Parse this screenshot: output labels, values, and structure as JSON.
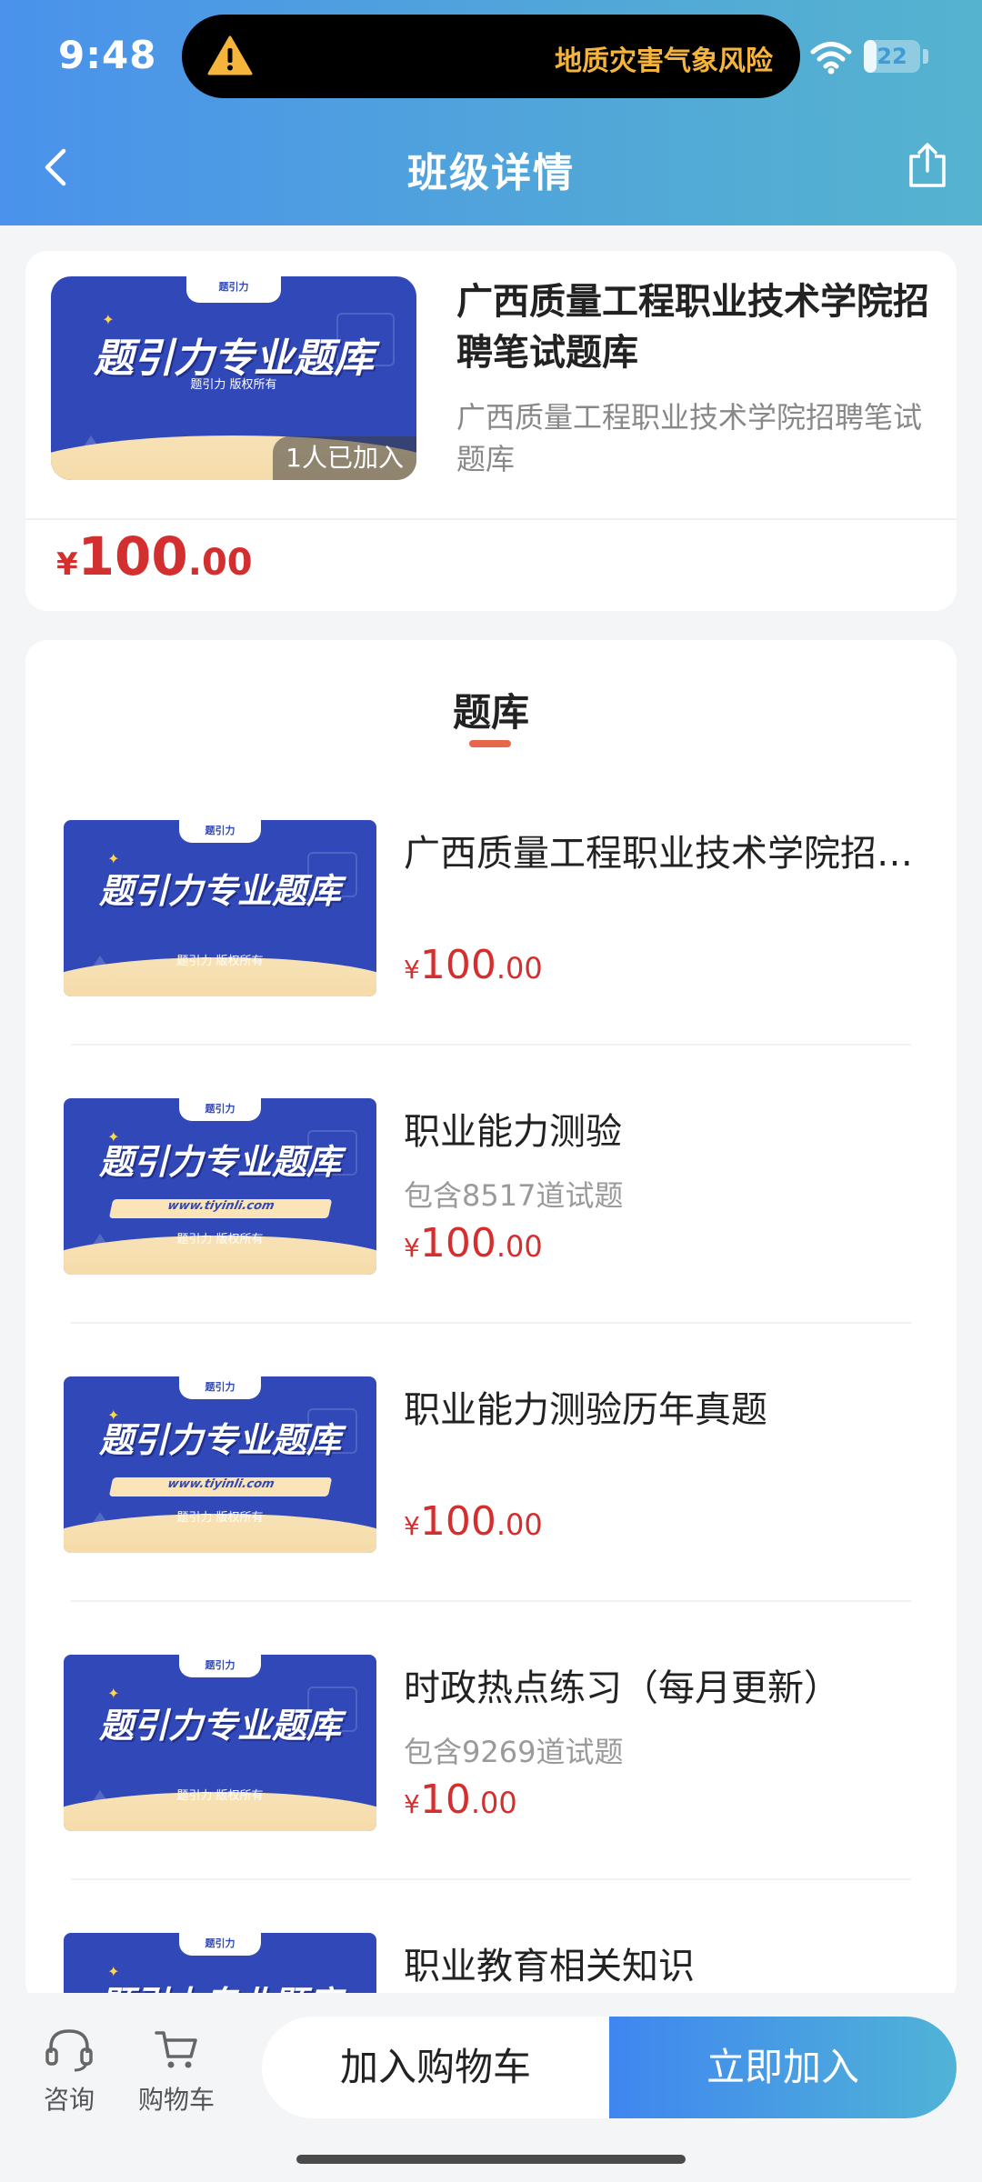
{
  "status_bar": {
    "time": "9:48",
    "alert_text": "地质灾害气象风险",
    "battery": "22",
    "battery_level": 0.22
  },
  "nav": {
    "title": "班级详情",
    "back_icon": "chevron-left-icon",
    "share_icon": "share-icon"
  },
  "summary": {
    "title": "广西质量工程职业技术学院招聘笔试题库",
    "subtitle": "广西质量工程职业技术学院招聘笔试题库",
    "joined": "1人已加入",
    "price": {
      "yen": "¥",
      "integer": "100",
      "decimal": ".00"
    }
  },
  "thumbnail": {
    "brand": "题引力",
    "title": "题引力专业题库",
    "copyright": "题引力 版权所有",
    "url": "www.tiyinli.com"
  },
  "section": {
    "title": "题库"
  },
  "banks": [
    {
      "title": "广西质量工程职业技术学院招聘笔试题库",
      "count": "",
      "price": {
        "yen": "¥",
        "integer": "100",
        "decimal": ".00"
      }
    },
    {
      "title": "职业能力测验",
      "count": "包含8517道试题",
      "price": {
        "yen": "¥",
        "integer": "100",
        "decimal": ".00"
      }
    },
    {
      "title": "职业能力测验历年真题",
      "count": "",
      "price": {
        "yen": "¥",
        "integer": "100",
        "decimal": ".00"
      }
    },
    {
      "title": "时政热点练习（每月更新）",
      "count": "包含9269道试题",
      "price": {
        "yen": "¥",
        "integer": "10",
        "decimal": ".00"
      }
    },
    {
      "title": "职业教育相关知识",
      "count": "",
      "price": {
        "yen": "",
        "integer": "",
        "decimal": ""
      }
    }
  ],
  "bottom_bar": {
    "consult_label": "咨询",
    "cart_label": "购物车",
    "add_to_cart": "加入购物车",
    "join_now": "立即加入"
  },
  "colors": {
    "header_start": "#4a92ec",
    "header_end": "#55b3cf",
    "price_red": "#d32f2f",
    "accent_underline": "#e8664a",
    "thumb_blue": "#3048b8",
    "alert_orange": "#f5b43b"
  }
}
